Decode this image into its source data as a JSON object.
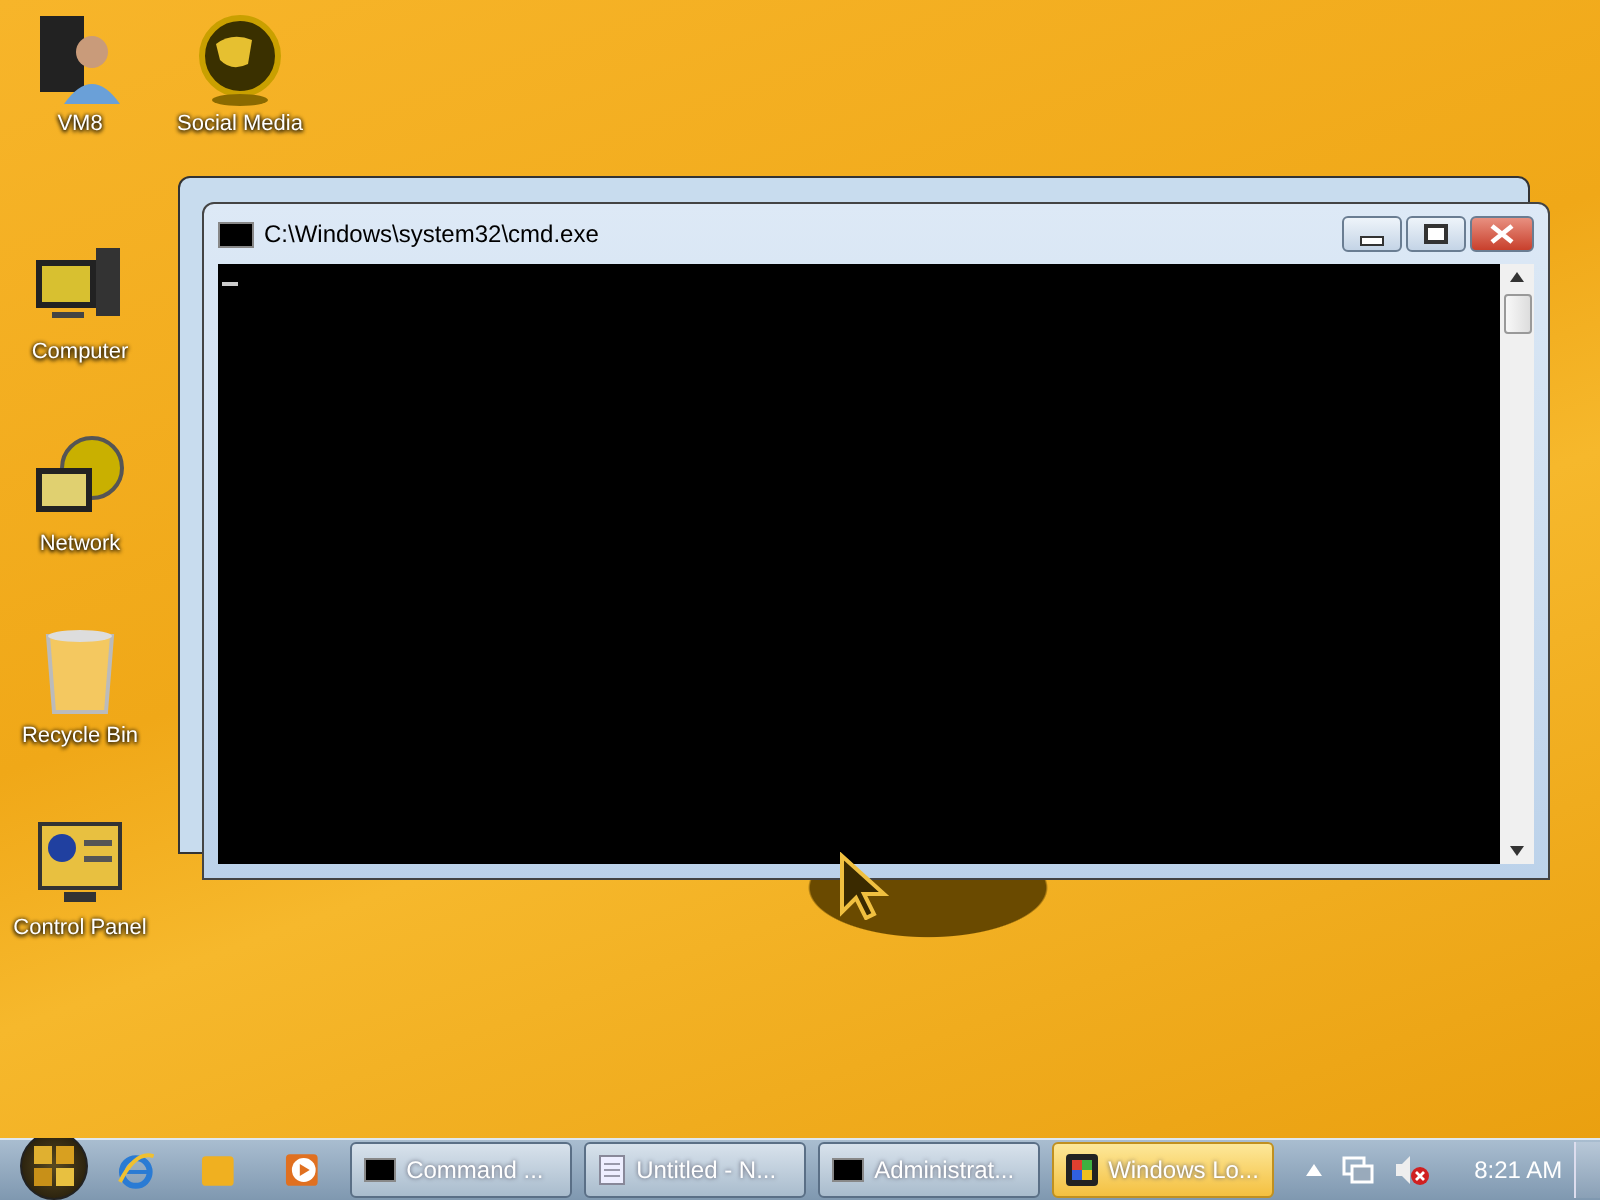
{
  "desktop_icons": [
    {
      "label": "VM8",
      "kind": "user"
    },
    {
      "label": "Social Media",
      "kind": "globe"
    },
    {
      "label": "Computer",
      "kind": "computer"
    },
    {
      "label": "Network",
      "kind": "network"
    },
    {
      "label": "Recycle Bin",
      "kind": "bin"
    },
    {
      "label": "Control Panel",
      "kind": "panel"
    }
  ],
  "window": {
    "title": "C:\\Windows\\system32\\cmd.exe"
  },
  "taskbar": {
    "buttons": [
      {
        "label": "Command ...",
        "kind": "cmd",
        "selected": false
      },
      {
        "label": "Untitled - N...",
        "kind": "notepad",
        "selected": false
      },
      {
        "label": "Administrat...",
        "kind": "cmd",
        "selected": false
      },
      {
        "label": "Windows Lo...",
        "kind": "app",
        "selected": true
      }
    ],
    "clock": "8:21 AM"
  }
}
